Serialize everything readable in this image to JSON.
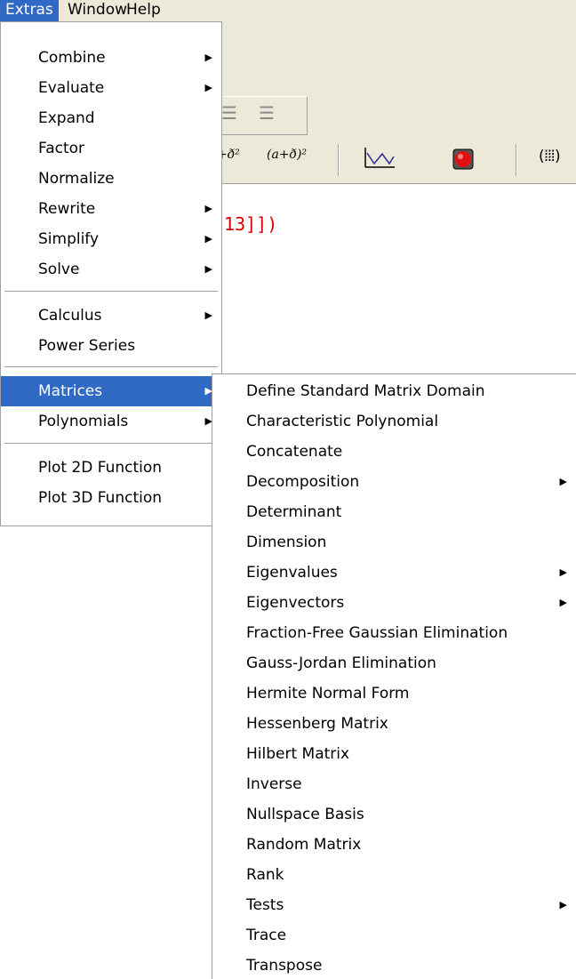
{
  "menubar": {
    "items": [
      "Extras",
      "Window",
      "Help"
    ]
  },
  "background": {
    "toolbar_tools": [
      "+ð²",
      "(a+ð)²"
    ],
    "expression_fragment": ".13]])"
  },
  "extras_menu": {
    "items": [
      {
        "label": "Combine",
        "submenu": true
      },
      {
        "label": "Evaluate",
        "submenu": true
      },
      {
        "label": "Expand",
        "submenu": false
      },
      {
        "label": "Factor",
        "submenu": false
      },
      {
        "label": "Normalize",
        "submenu": false
      },
      {
        "label": "Rewrite",
        "submenu": true
      },
      {
        "label": "Simplify",
        "submenu": true
      },
      {
        "label": "Solve",
        "submenu": true
      },
      {
        "label": "Calculus",
        "submenu": true
      },
      {
        "label": "Power Series",
        "submenu": false
      },
      {
        "label": "Matrices",
        "submenu": true,
        "highlighted": true
      },
      {
        "label": "Polynomials",
        "submenu": true
      },
      {
        "label": "Plot 2D Function",
        "submenu": false
      },
      {
        "label": "Plot 3D Function",
        "submenu": false
      }
    ]
  },
  "matrices_submenu": {
    "items": [
      {
        "label": "Define Standard Matrix Domain",
        "submenu": false
      },
      {
        "label": "Characteristic Polynomial",
        "submenu": false
      },
      {
        "label": "Concatenate",
        "submenu": false
      },
      {
        "label": "Decomposition",
        "submenu": true
      },
      {
        "label": "Determinant",
        "submenu": false
      },
      {
        "label": "Dimension",
        "submenu": false
      },
      {
        "label": "Eigenvalues",
        "submenu": true
      },
      {
        "label": "Eigenvectors",
        "submenu": true
      },
      {
        "label": "Fraction-Free Gaussian Elimination",
        "submenu": false
      },
      {
        "label": "Gauss-Jordan Elimination",
        "submenu": false
      },
      {
        "label": "Hermite Normal Form",
        "submenu": false
      },
      {
        "label": "Hessenberg Matrix",
        "submenu": false
      },
      {
        "label": "Hilbert Matrix",
        "submenu": false
      },
      {
        "label": "Inverse",
        "submenu": false
      },
      {
        "label": "Nullspace Basis",
        "submenu": false
      },
      {
        "label": "Random Matrix",
        "submenu": false
      },
      {
        "label": "Rank",
        "submenu": false
      },
      {
        "label": "Tests",
        "submenu": true
      },
      {
        "label": "Trace",
        "submenu": false
      },
      {
        "label": "Transpose",
        "submenu": false
      }
    ]
  },
  "arrow_glyph": "▶",
  "colors": {
    "highlight": "#316ac5",
    "menubar_bg": "#ece9d8",
    "expression_red": "#d40000"
  }
}
